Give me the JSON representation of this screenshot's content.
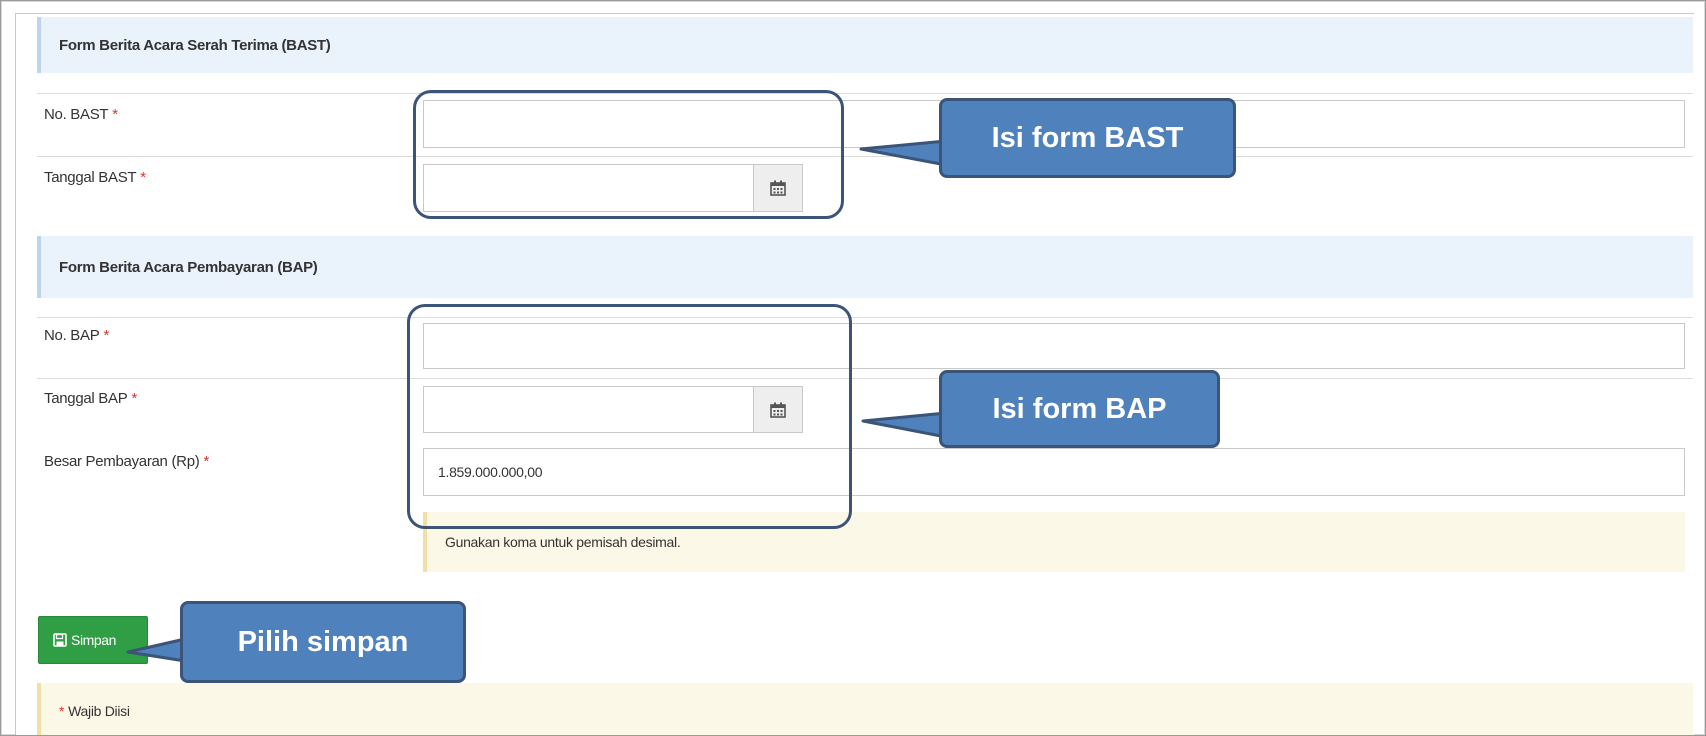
{
  "bast_section": {
    "title": "Form Berita Acara Serah Terima (BAST)",
    "no_label": "No. BAST",
    "date_label": "Tanggal BAST",
    "no_value": "",
    "date_value": ""
  },
  "bap_section": {
    "title": "Form Berita Acara Pembayaran (BAP)",
    "no_label": "No. BAP",
    "date_label": "Tanggal BAP",
    "amount_label": "Besar Pembayaran (Rp)",
    "no_value": "",
    "date_value": "",
    "amount_value": "1.859.000.000,00",
    "hint": "Gunakan koma untuk pemisah desimal."
  },
  "required_mark": "*",
  "save_button": {
    "label": "Simpan",
    "icon": "floppy-disk-icon"
  },
  "footer_note": "Wajib Diisi",
  "callouts": {
    "bast": "Isi form BAST",
    "bap": "Isi form BAP",
    "save": "Pilih simpan"
  },
  "colors": {
    "callout_fill": "#4f81bd",
    "callout_border": "#3c5478",
    "save_button": "#2f9e44",
    "required": "#d9342b",
    "section_head_bg": "#eaf2fb",
    "hint_bg": "#fcf8e8"
  }
}
